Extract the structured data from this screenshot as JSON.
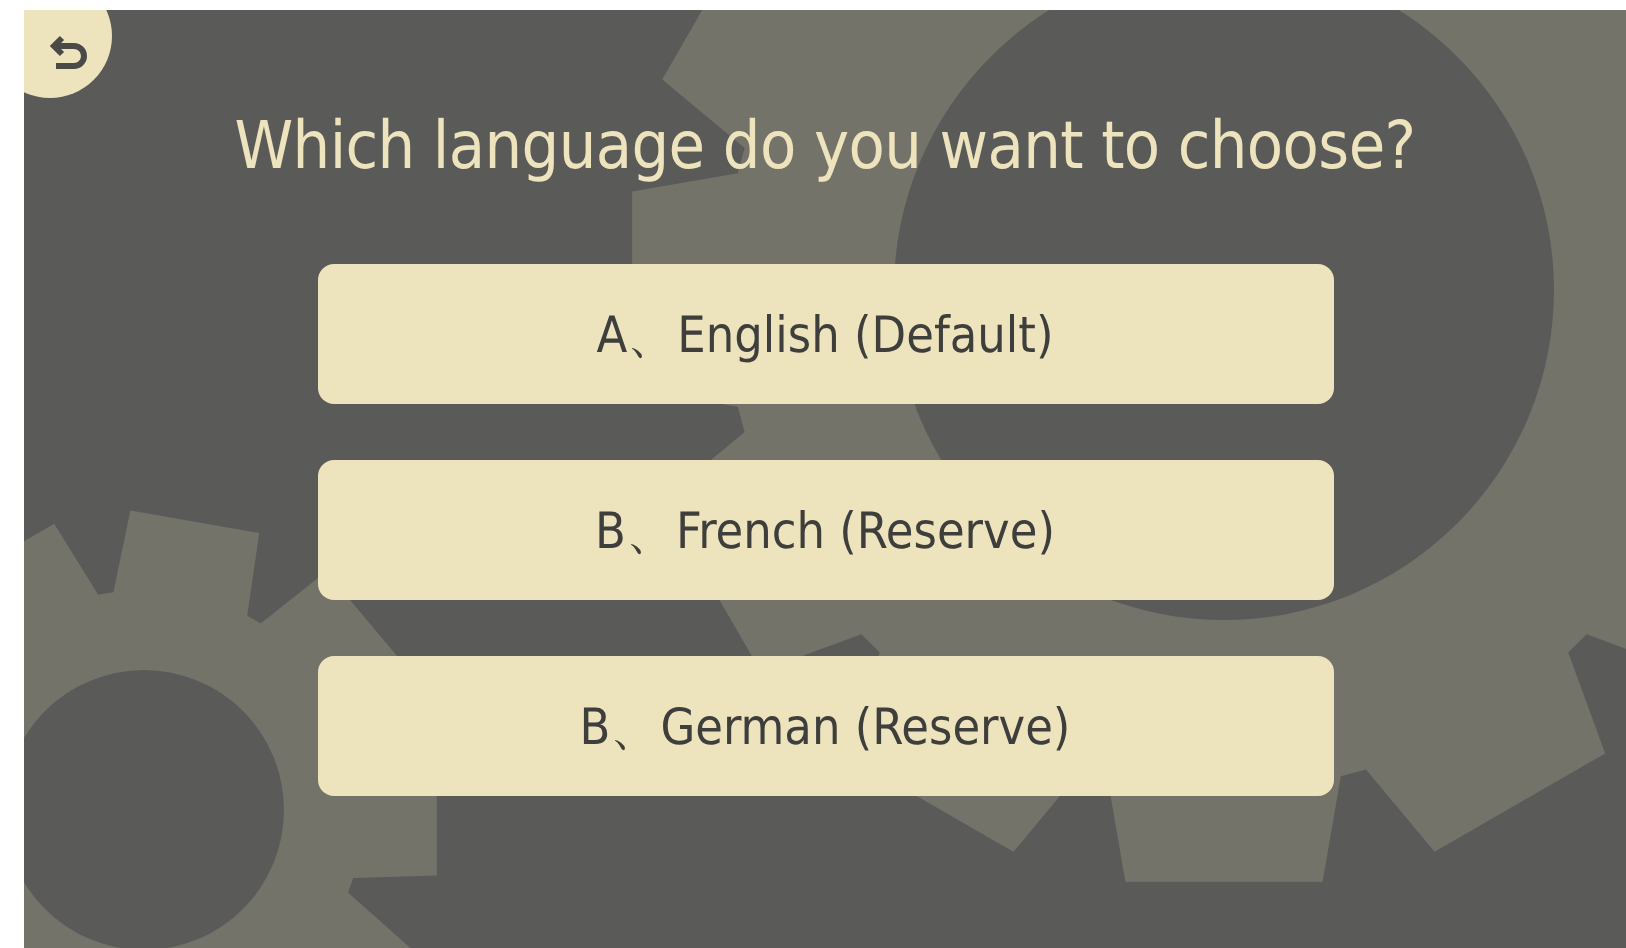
{
  "title": "Which language do you want to choose?",
  "options": [
    {
      "label": "A、English (Default)"
    },
    {
      "label": "B、French (Reserve)"
    },
    {
      "label": "B、German (Reserve)"
    }
  ]
}
